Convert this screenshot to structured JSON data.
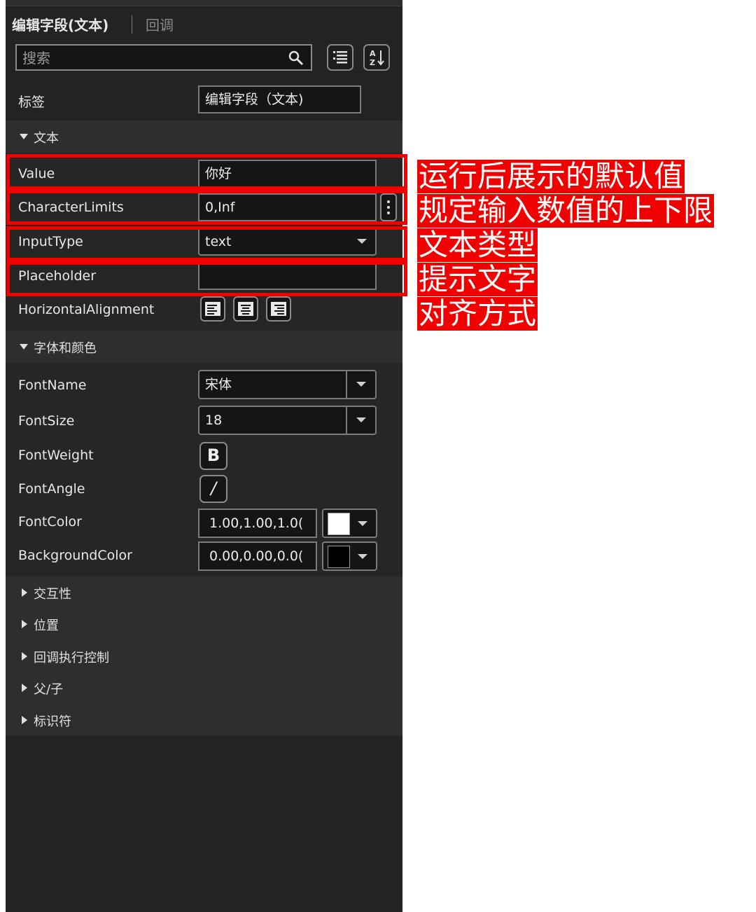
{
  "tabs": {
    "active": "编辑字段(文本)",
    "inactive": "回调"
  },
  "search": {
    "placeholder": "搜索"
  },
  "label_row": {
    "label": "标签",
    "value": "编辑字段（文本)"
  },
  "text_section": {
    "title": "文本",
    "rows": {
      "value": {
        "label": "Value",
        "value": "你好"
      },
      "character_limits": {
        "label": "CharacterLimits",
        "value": "0,Inf"
      },
      "input_type": {
        "label": "InputType",
        "value": "text"
      },
      "placeholder": {
        "label": "Placeholder",
        "value": ""
      },
      "horizontal_alignment": {
        "label": "HorizontalAlignment"
      }
    }
  },
  "font_section": {
    "title": "字体和颜色",
    "rows": {
      "font_name": {
        "label": "FontName",
        "value": "宋体"
      },
      "font_size": {
        "label": "FontSize",
        "value": "18"
      },
      "font_weight": {
        "label": "FontWeight",
        "button": "B"
      },
      "font_angle": {
        "label": "FontAngle",
        "button": "/"
      },
      "font_color": {
        "label": "FontColor",
        "value": "1.00,1.00,1.0(",
        "swatch": "#ffffff"
      },
      "background_color": {
        "label": "BackgroundColor",
        "value": "0.00,0.00,0.0(",
        "swatch": "#000000"
      }
    }
  },
  "collapsed_sections": [
    "交互性",
    "位置",
    "回调执行控制",
    "父/子",
    "标识符"
  ],
  "annotations": {
    "value": "运行后展示的默认值",
    "limits": "规定输入数值的上下限",
    "type": "文本类型",
    "placeholder": "提示文字",
    "alignment": "对齐方式"
  },
  "colors": {
    "panel_bg": "#232323",
    "section_bg": "#2e2e2e",
    "highlight": "#f20000"
  }
}
